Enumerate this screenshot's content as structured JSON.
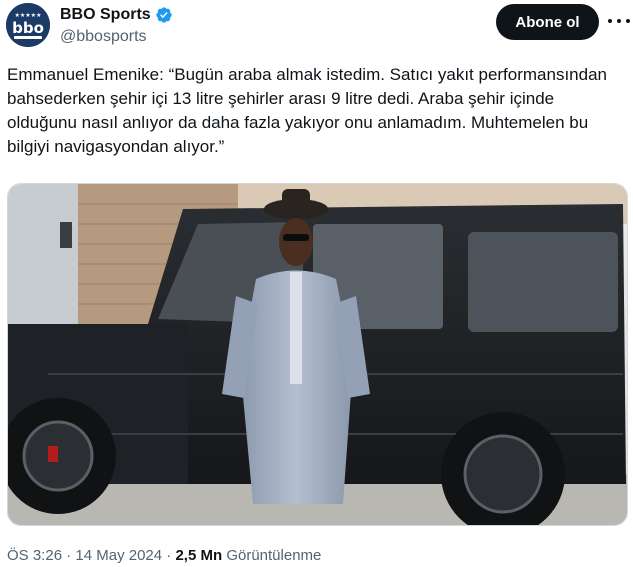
{
  "author": {
    "display_name": "BBO Sports",
    "handle": "@bbosports",
    "verified": true,
    "avatar_icon": "bbo-sports-logo",
    "avatar_text": "bbo",
    "brand_color": "#1b3a66"
  },
  "actions": {
    "follow_label": "Abone ol",
    "more_icon": "more-dots-icon"
  },
  "tweet": {
    "text": "Emmanuel Emenike: “Bugün araba almak istedim. Satıcı yakıt performansından bahsederken şehir içi 13 litre şehirler arası 9 litre dedi. Araba şehir içinde olduğunu nasıl anlıyor da daha fazla yakıyor onu anlamadım. Muhtemelen bu bilgiyi navigasyondan alıyor.”",
    "image": "Man in light blue kaftan and black hat standing in front of a black SUV"
  },
  "meta": {
    "time": "ÖS 3:26",
    "separator": "·",
    "date": "14 May 2024",
    "views_count": "2,5 Mn",
    "views_label": "Görüntülenme"
  },
  "colors": {
    "text": "#0f1419",
    "secondary": "#536471",
    "verified_blue": "#1d9bf0",
    "button_bg": "#0f1419"
  }
}
